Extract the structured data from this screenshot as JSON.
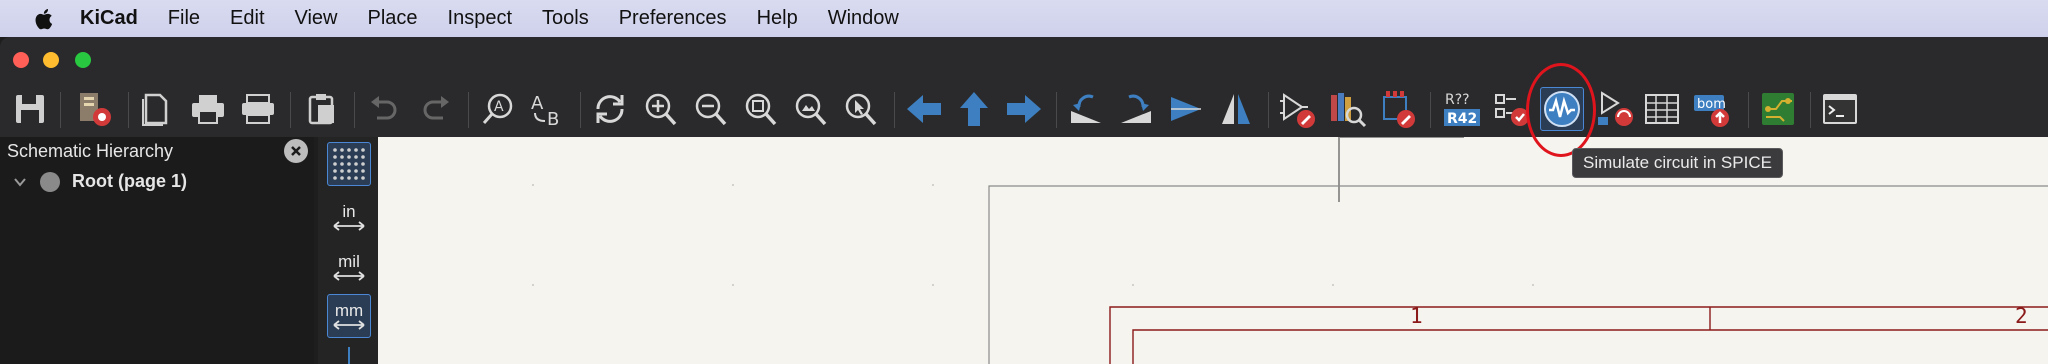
{
  "menubar": {
    "app": "KiCad",
    "items": [
      "File",
      "Edit",
      "View",
      "Place",
      "Inspect",
      "Tools",
      "Preferences",
      "Help",
      "Window"
    ]
  },
  "toolbar": {
    "buttons": [
      {
        "name": "save",
        "icon": "save-icon"
      },
      {
        "name": "schematic-setup",
        "icon": "schematic-setup-icon"
      },
      {
        "name": "page-settings",
        "icon": "page-settings-icon"
      },
      {
        "name": "print",
        "icon": "print-icon"
      },
      {
        "name": "plot",
        "icon": "plot-icon"
      },
      {
        "name": "paste",
        "icon": "paste-icon"
      },
      {
        "name": "undo",
        "icon": "undo-icon"
      },
      {
        "name": "redo",
        "icon": "redo-icon"
      },
      {
        "name": "find",
        "icon": "find-icon"
      },
      {
        "name": "find-replace",
        "icon": "find-replace-icon"
      },
      {
        "name": "refresh",
        "icon": "refresh-icon"
      },
      {
        "name": "zoom-in",
        "icon": "zoom-in-icon"
      },
      {
        "name": "zoom-out",
        "icon": "zoom-out-icon"
      },
      {
        "name": "zoom-fit",
        "icon": "zoom-fit-icon"
      },
      {
        "name": "zoom-objects",
        "icon": "zoom-objects-icon"
      },
      {
        "name": "zoom-selection",
        "icon": "zoom-selection-icon"
      },
      {
        "name": "navigate-back",
        "icon": "arrow-left-icon"
      },
      {
        "name": "navigate-up",
        "icon": "arrow-up-icon"
      },
      {
        "name": "navigate-forward",
        "icon": "arrow-right-icon"
      },
      {
        "name": "rotate-ccw",
        "icon": "rotate-ccw-icon"
      },
      {
        "name": "rotate-cw",
        "icon": "rotate-cw-icon"
      },
      {
        "name": "mirror-vertical",
        "icon": "mirror-v-icon"
      },
      {
        "name": "mirror-horizontal",
        "icon": "mirror-h-icon"
      },
      {
        "name": "symbol-editor",
        "icon": "symbol-editor-icon"
      },
      {
        "name": "symbol-browser",
        "icon": "library-browser-icon"
      },
      {
        "name": "footprint-editor",
        "icon": "footprint-editor-icon"
      },
      {
        "name": "annotate",
        "icon": "annotate-icon"
      },
      {
        "name": "erc",
        "icon": "erc-icon"
      },
      {
        "name": "simulator",
        "icon": "simulator-icon"
      },
      {
        "name": "assign-footprints",
        "icon": "assign-footprints-icon"
      },
      {
        "name": "bulk-edit-fields",
        "icon": "table-icon"
      },
      {
        "name": "generate-bom",
        "icon": "bom-icon"
      },
      {
        "name": "open-pcb",
        "icon": "pcb-icon"
      },
      {
        "name": "scripting-console",
        "icon": "terminal-icon"
      }
    ],
    "annotate_text_top": "R??",
    "annotate_text_bottom": "R42",
    "bom_text": "bom"
  },
  "tooltip": "Simulate circuit in SPICE",
  "hierarchy": {
    "title": "Schematic Hierarchy",
    "root_label": "Root (page 1)"
  },
  "left_toolbar": {
    "inch": "in",
    "mil": "mil",
    "mm": "mm"
  },
  "canvas": {
    "column_1": "1",
    "column_2": "2"
  }
}
